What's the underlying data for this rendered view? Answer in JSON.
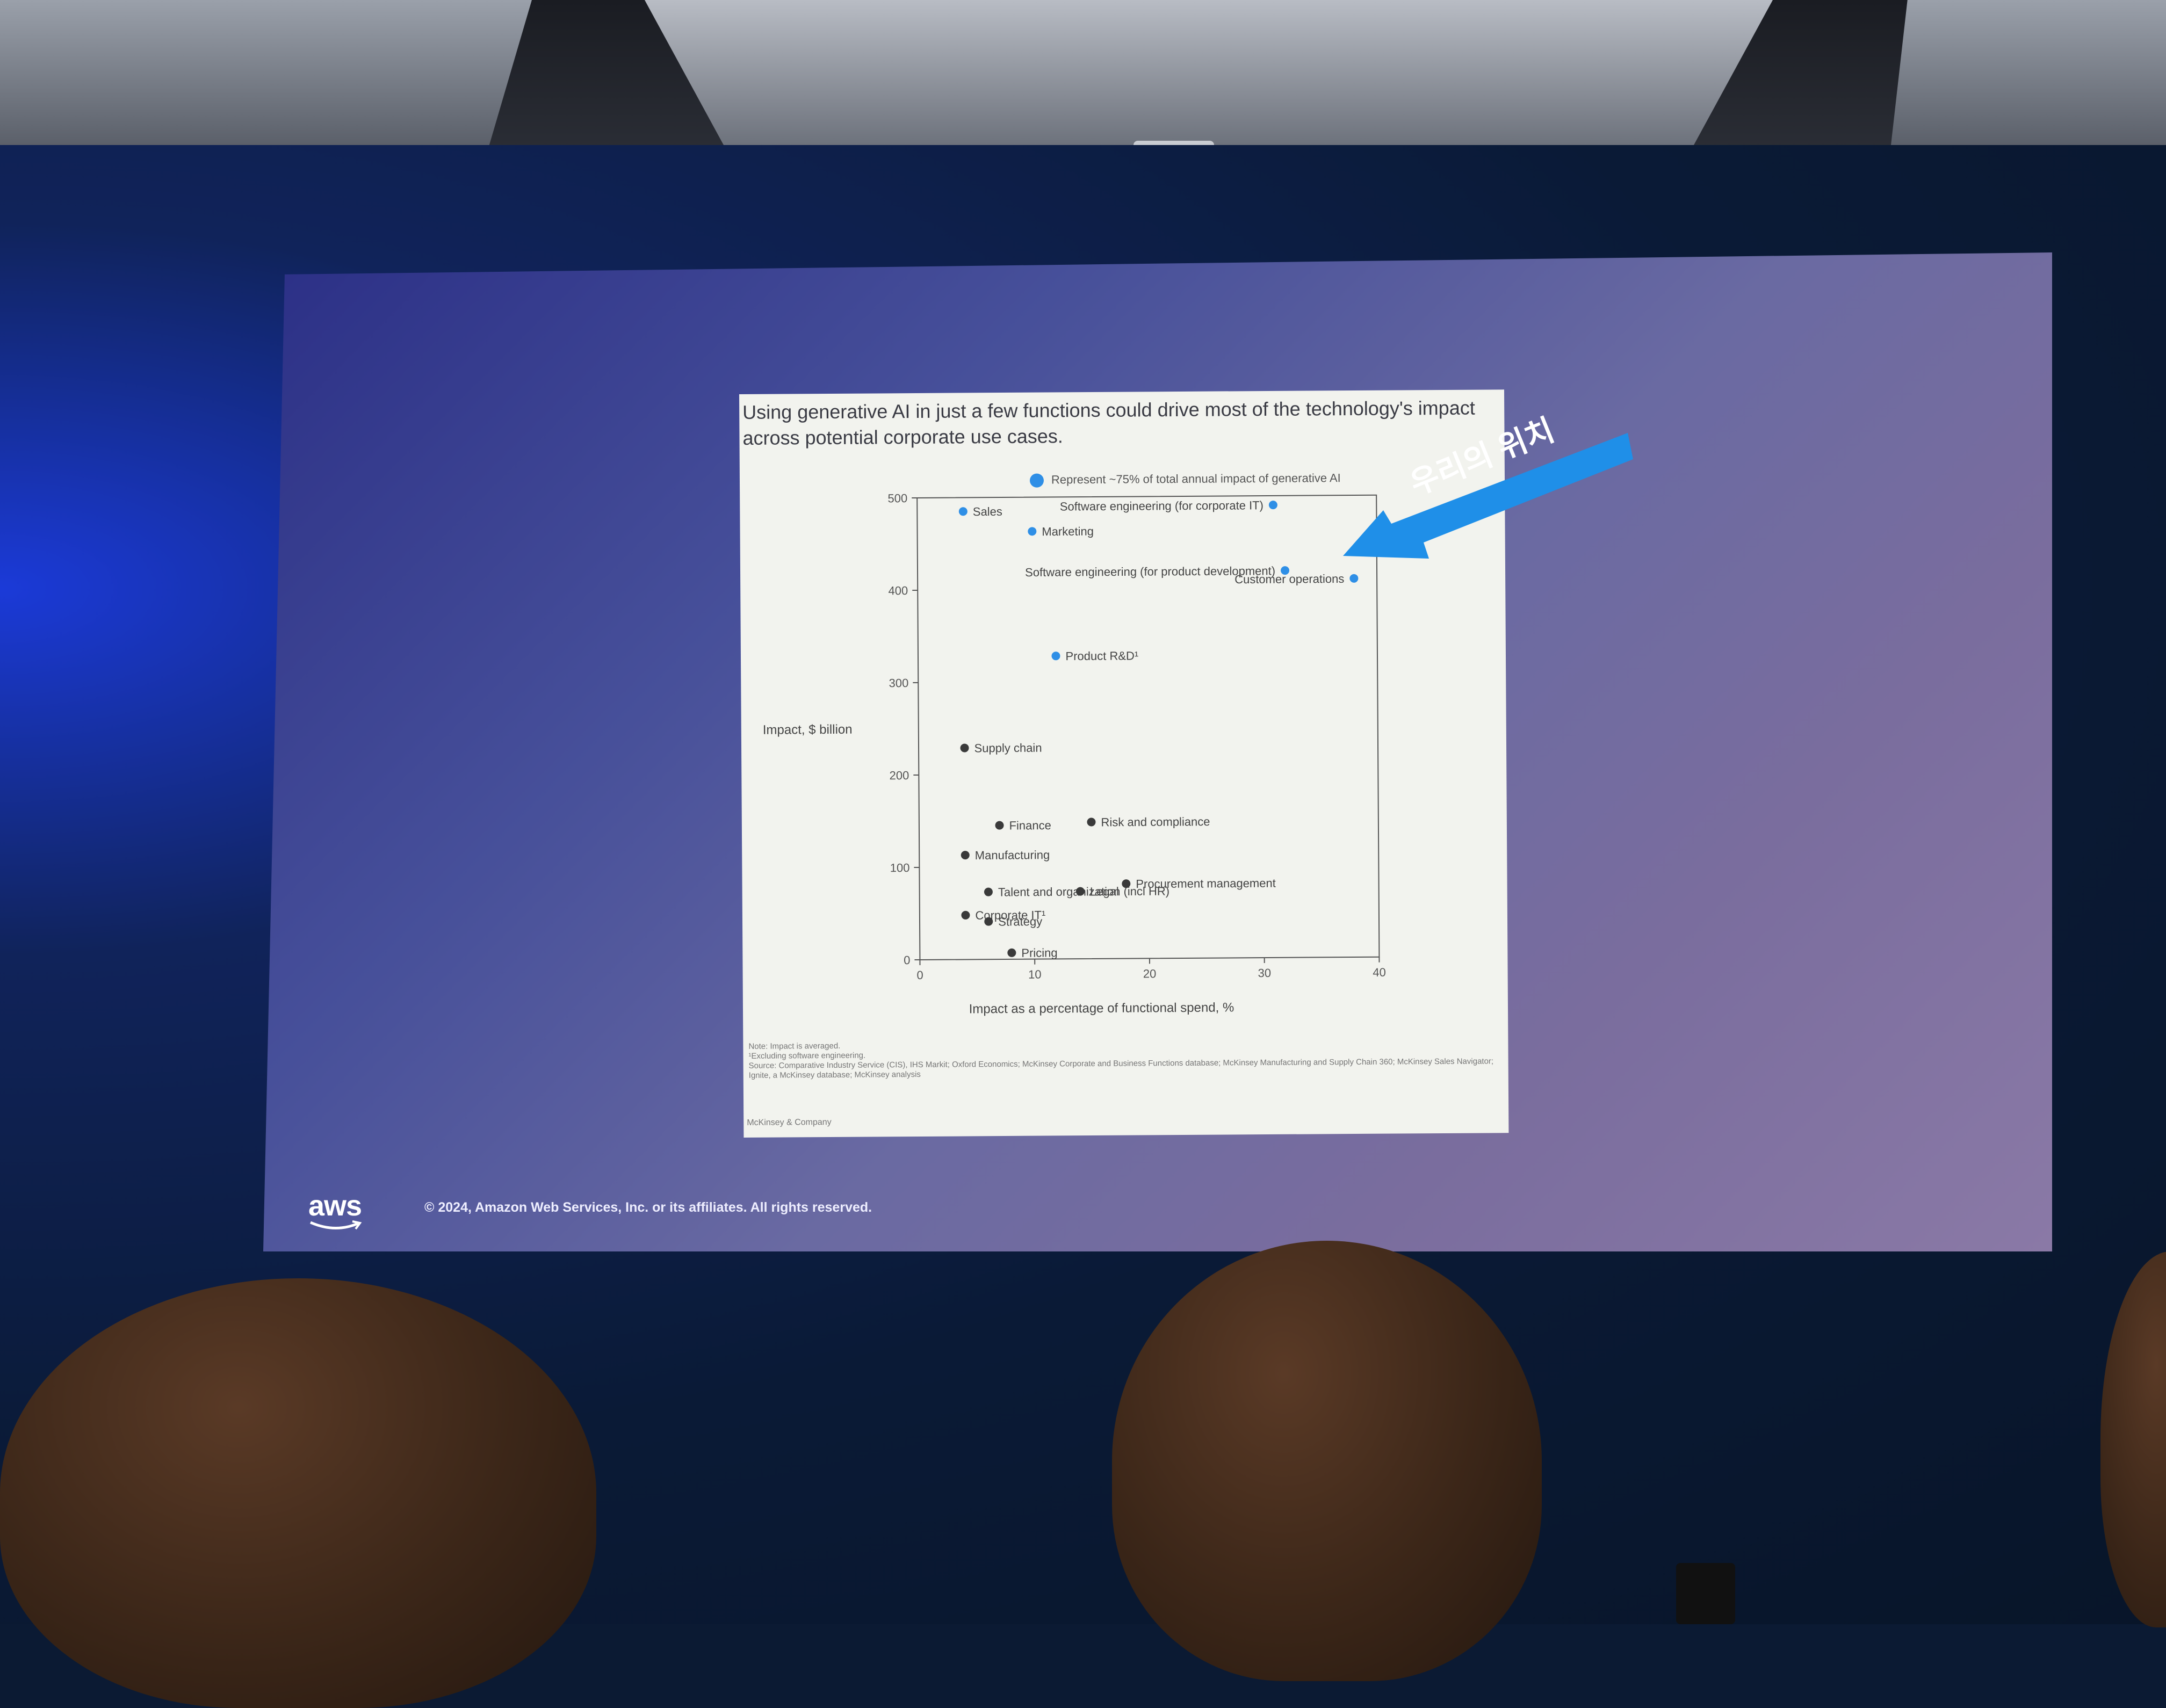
{
  "slide": {
    "title": "Using generative AI in just a few functions could drive most of the technology's impact across potential corporate use cases.",
    "legend_text": "Represent ~75% of total annual impact of generative AI",
    "notes": [
      "Note: Impact is averaged.",
      "¹Excluding software engineering.",
      "Source: Comparative Industry Service (CIS), IHS Markit; Oxford Economics; McKinsey Corporate and Business Functions database; McKinsey Manufacturing and Supply Chain 360; McKinsey Sales Navigator; Ignite, a McKinsey database; McKinsey analysis"
    ],
    "brand": "McKinsey & Company"
  },
  "annotation": {
    "text": "우리의 위치",
    "color": "#1f8fe8"
  },
  "footer": {
    "logo_text": "aws",
    "copyright": "© 2024, Amazon Web Services, Inc. or its affiliates. All rights reserved."
  },
  "colors": {
    "highlight": "#2f8fe6",
    "other": "#3a3a3a",
    "axis": "#555555"
  },
  "chart_data": {
    "type": "scatter",
    "title": "Using generative AI in just a few functions could drive most of the technology's impact across potential corporate use cases.",
    "xlabel": "Impact as a percentage of functional spend, %",
    "ylabel": "Impact, $ billion",
    "xlim": [
      0,
      40
    ],
    "ylim": [
      0,
      500
    ],
    "xticks": [
      0,
      10,
      20,
      30,
      40
    ],
    "yticks": [
      0,
      100,
      200,
      300,
      400,
      500
    ],
    "grid": false,
    "points": [
      {
        "label": "Sales",
        "x": 4,
        "y": 485,
        "highlight": true
      },
      {
        "label": "Marketing",
        "x": 10,
        "y": 463,
        "highlight": true
      },
      {
        "label": "Software engineering (for corporate IT)",
        "x": 31,
        "y": 490,
        "highlight": true
      },
      {
        "label": "Software engineering (for product development)",
        "x": 32,
        "y": 419,
        "highlight": true
      },
      {
        "label": "Customer operations",
        "x": 38,
        "y": 410,
        "highlight": true
      },
      {
        "label": "Product R&D¹",
        "x": 12,
        "y": 328,
        "highlight": true
      },
      {
        "label": "Supply chain",
        "x": 4,
        "y": 229,
        "highlight": false
      },
      {
        "label": "Finance",
        "x": 7,
        "y": 145,
        "highlight": false
      },
      {
        "label": "Risk and compliance",
        "x": 15,
        "y": 148,
        "highlight": false
      },
      {
        "label": "Manufacturing",
        "x": 4,
        "y": 113,
        "highlight": false
      },
      {
        "label": "Talent and organization (incl HR)",
        "x": 6,
        "y": 73,
        "highlight": false
      },
      {
        "label": "Procurement management",
        "x": 18,
        "y": 81,
        "highlight": false
      },
      {
        "label": "Legal",
        "x": 14,
        "y": 73,
        "highlight": false
      },
      {
        "label": "Corporate IT¹",
        "x": 4,
        "y": 48,
        "highlight": false
      },
      {
        "label": "Strategy",
        "x": 6,
        "y": 41,
        "highlight": false
      },
      {
        "label": "Pricing",
        "x": 8,
        "y": 7,
        "highlight": false
      }
    ]
  }
}
